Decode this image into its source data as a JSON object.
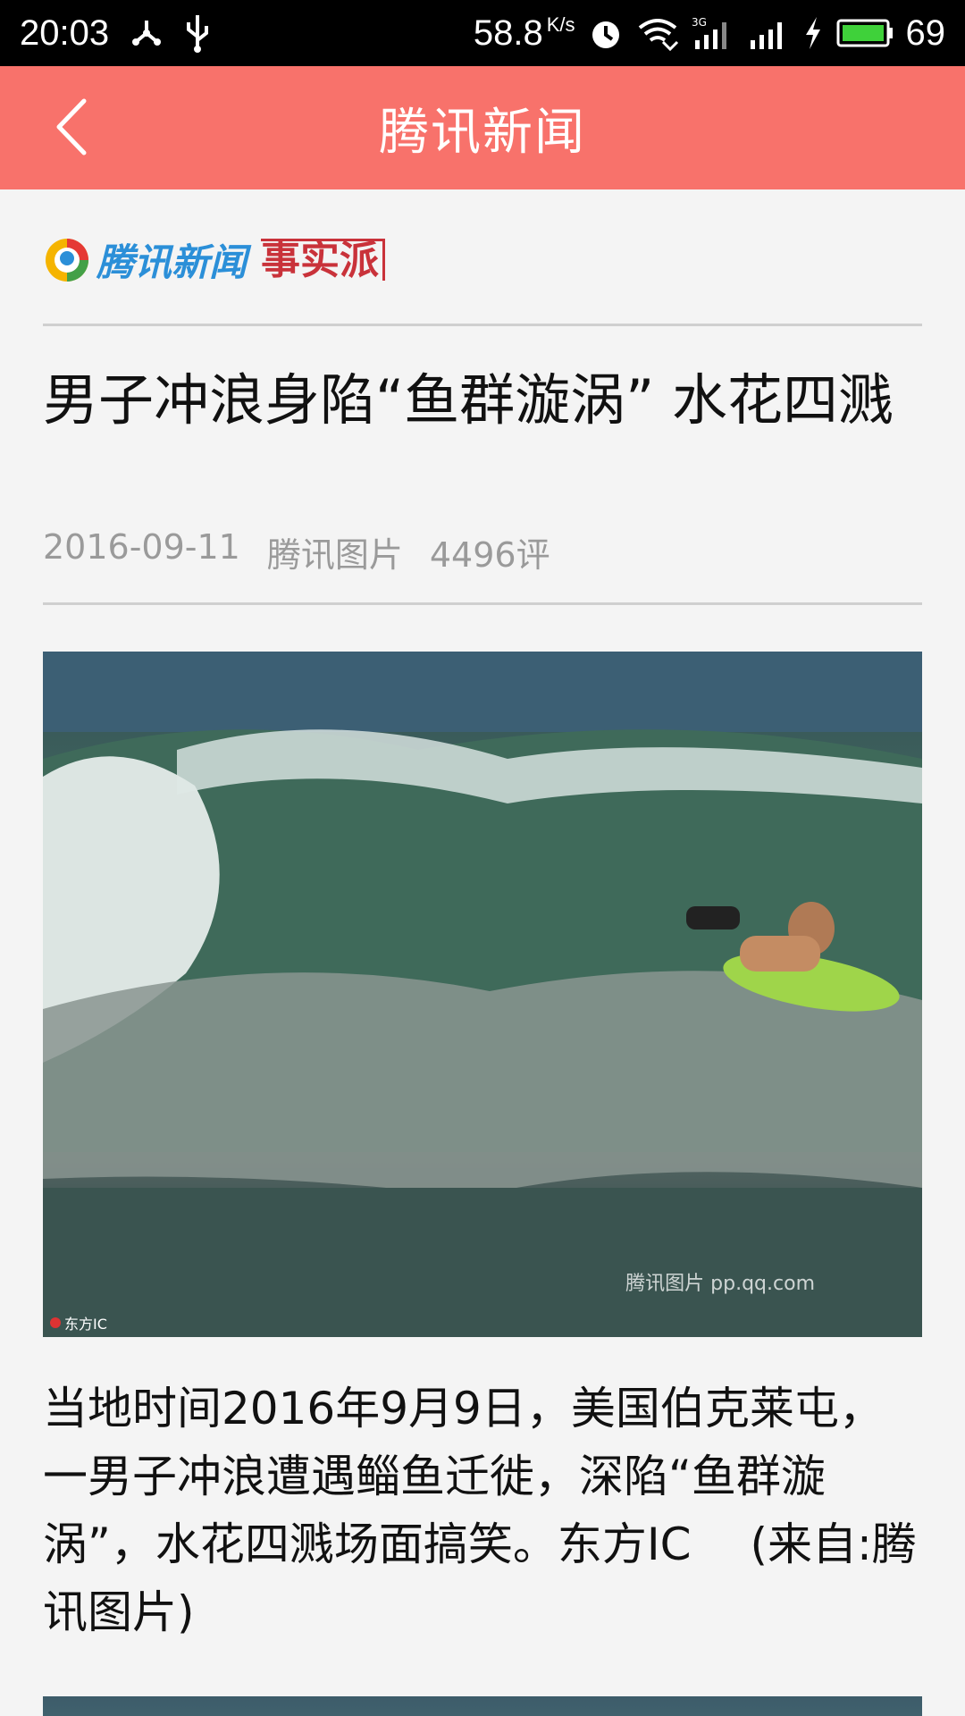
{
  "status_bar": {
    "time": "20:03",
    "speed": "58.8",
    "speed_unit": "K/s",
    "network": "3G",
    "battery": "69",
    "icons": [
      "usb-debug-icon",
      "usb-icon",
      "alarm-icon",
      "wifi-icon",
      "signal-3g-icon",
      "signal-icon",
      "charging-icon",
      "battery-icon"
    ]
  },
  "app_bar": {
    "title": "腾讯新闻",
    "back_icon": "chevron-left-icon",
    "background": "#f8726b"
  },
  "article": {
    "brand_name": "腾讯新闻",
    "brand_sub": "事实派",
    "headline": "男子冲浪身陷“鱼群漩涡” 水花四溅",
    "date": "2016-09-11",
    "source": "腾讯图片",
    "comments": "4496评",
    "photo_credit_left": "东方IC",
    "photo_credit_right": "腾讯图片 pp.qq.com",
    "caption": "当地时间2016年9月9日，美国伯克莱屯，一男子冲浪遭遇鲻鱼迁徙，深陷“鱼群漩涡”，水花四溅场面搞笑。东方IC　 (来自:腾讯图片)"
  },
  "colors": {
    "accent": "#f8726b",
    "brand_blue": "#2b8fd8",
    "brand_red": "#c9323a",
    "meta_gray": "#9a9a9a"
  }
}
